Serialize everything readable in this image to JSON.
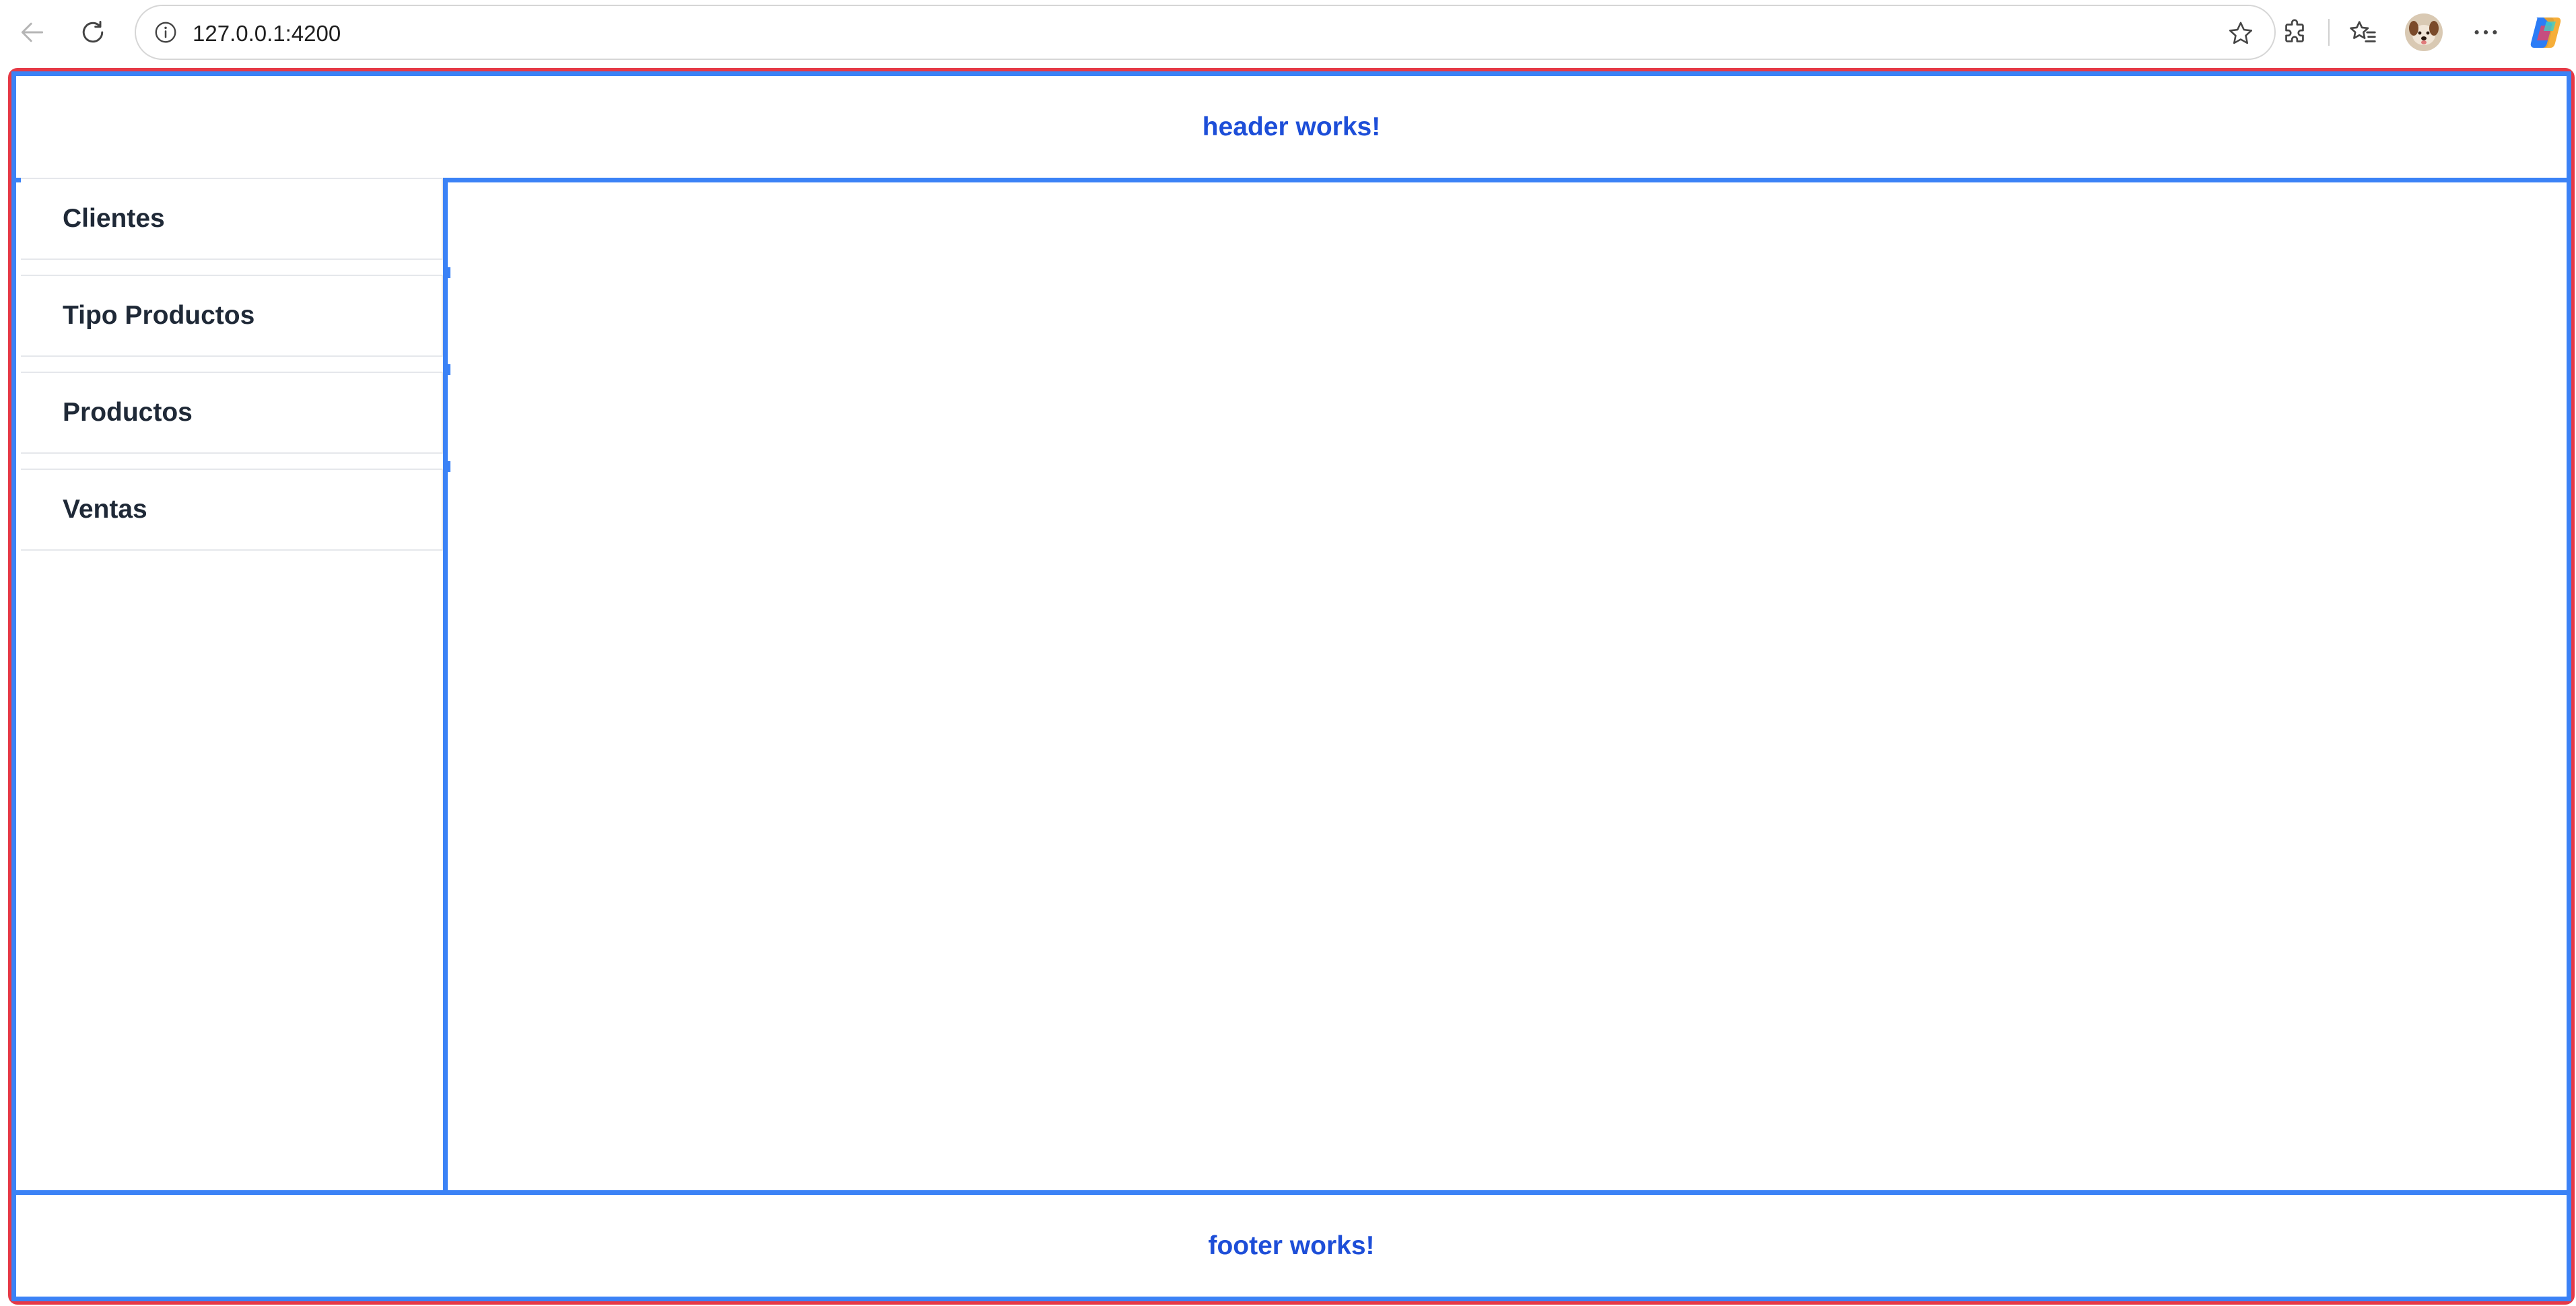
{
  "browser": {
    "url": "127.0.0.1:4200",
    "icons": {
      "back": "back-arrow-icon",
      "reload": "reload-icon",
      "info": "info-icon",
      "favorite": "star-icon",
      "extensions": "extensions-icon",
      "favorites": "favorites-list-icon",
      "profile": "profile-avatar",
      "menu": "more-options-icon",
      "copilot": "copilot-icon"
    }
  },
  "app": {
    "header_text": "header works!",
    "footer_text": "footer works!",
    "sidebar": {
      "items": [
        {
          "label": "Clientes"
        },
        {
          "label": "Tipo Productos"
        },
        {
          "label": "Productos"
        },
        {
          "label": "Ventas"
        }
      ]
    }
  },
  "colors": {
    "frame_outer": "#e63946",
    "frame_blue": "#3b82f6",
    "header_text": "#1d4ed8",
    "menu_text": "#1f2937"
  }
}
